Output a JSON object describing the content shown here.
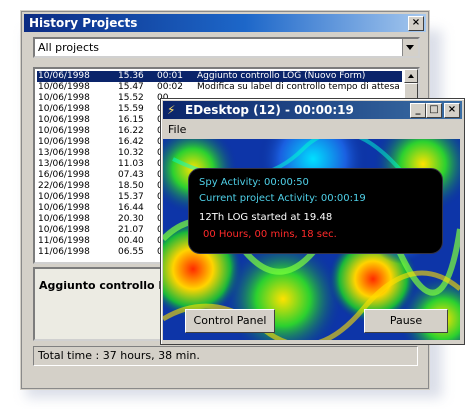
{
  "history": {
    "title": "History Projects",
    "close_label": "×",
    "filter_value": "All projects",
    "rows": [
      {
        "date": "10/06/1998",
        "time": "15.36",
        "dur": "00:01",
        "desc": "Aggiunto controllo LOG (Nuovo Form)"
      },
      {
        "date": "10/06/1998",
        "time": "15.47",
        "dur": "00:02",
        "desc": "Modifica su label di controllo tempo di attesa"
      },
      {
        "date": "10/06/1998",
        "time": "15.52",
        "dur": "00",
        "desc": ""
      },
      {
        "date": "10/06/1998",
        "time": "15.59",
        "dur": "0",
        "desc": ""
      },
      {
        "date": "10/06/1998",
        "time": "16.15",
        "dur": "0",
        "desc": ""
      },
      {
        "date": "10/06/1998",
        "time": "16.22",
        "dur": "0",
        "desc": ""
      },
      {
        "date": "10/06/1998",
        "time": "16.42",
        "dur": "0",
        "desc": ""
      },
      {
        "date": "13/06/1998",
        "time": "10.32",
        "dur": "0",
        "desc": ""
      },
      {
        "date": "13/06/1998",
        "time": "11.03",
        "dur": "0",
        "desc": ""
      },
      {
        "date": "16/06/1998",
        "time": "07.43",
        "dur": "0",
        "desc": ""
      },
      {
        "date": "22/06/1998",
        "time": "18.50",
        "dur": "0",
        "desc": ""
      },
      {
        "date": "10/06/1998",
        "time": "15.37",
        "dur": "0",
        "desc": ""
      },
      {
        "date": "10/06/1998",
        "time": "16.44",
        "dur": "0",
        "desc": ""
      },
      {
        "date": "10/06/1998",
        "time": "20.30",
        "dur": "0",
        "desc": ""
      },
      {
        "date": "10/06/1998",
        "time": "21.07",
        "dur": "0",
        "desc": ""
      },
      {
        "date": "11/06/1998",
        "time": "00.40",
        "dur": "0",
        "desc": ""
      },
      {
        "date": "11/06/1998",
        "time": "06.55",
        "dur": "0",
        "desc": ""
      }
    ],
    "detail_text": "Aggiunto controllo LO",
    "total_time": "Total time : 37 hours, 38 min."
  },
  "edesktop": {
    "title": "EDesktop (12) - 00:00:19",
    "min_label": "_",
    "max_label": "□",
    "close_label": "×",
    "menu_file": "File",
    "spy_activity": "Spy Activity: 00:00:50",
    "current_activity": "Current project Activity: 00:00:19",
    "log_started": "12Th LOG started at 19.48",
    "elapsed": "00 Hours, 00 mins, 18 sec.",
    "control_panel_label": "Control Panel",
    "pause_label": "Pause",
    "colors": {
      "cyan_text": "#4fd0e8",
      "white_text": "#ffffff",
      "red_text": "#ff2a2a"
    }
  }
}
